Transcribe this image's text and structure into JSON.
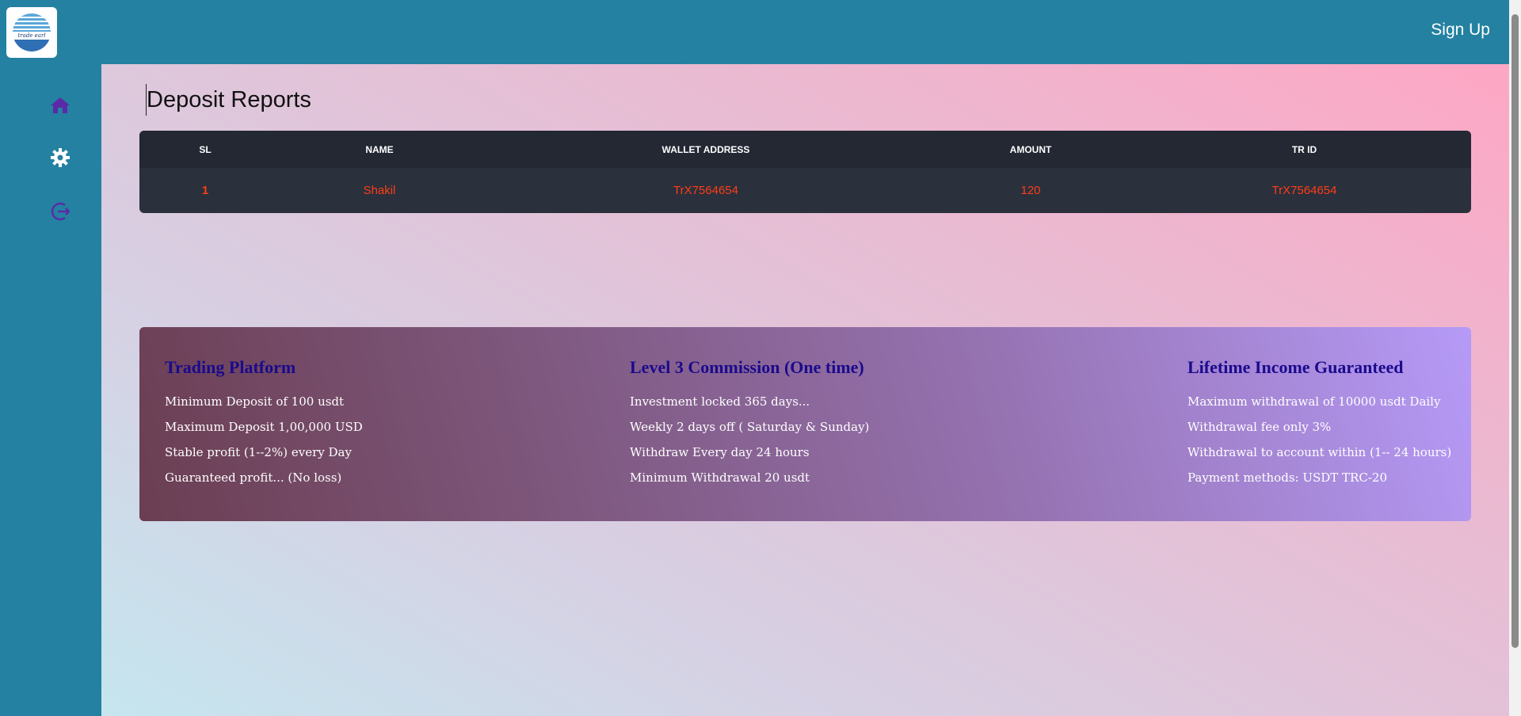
{
  "header": {
    "logo_text": "trade earl",
    "signup_label": "Sign Up"
  },
  "sidebar": {
    "items": [
      {
        "icon": "home-icon"
      },
      {
        "icon": "gear-icon"
      },
      {
        "icon": "logout-icon"
      }
    ]
  },
  "page": {
    "title": "Deposit Reports"
  },
  "table": {
    "headers": [
      "SL",
      "NAME",
      "WALLET ADDRESS",
      "AMOUNT",
      "TR ID"
    ],
    "rows": [
      [
        "1",
        "Shakil",
        "TrX7564654",
        "120",
        "TrX7564654"
      ]
    ]
  },
  "info": {
    "columns": [
      {
        "title": "Trading Platform",
        "lines": [
          "Minimum Deposit of 100 usdt",
          "Maximum Deposit 1,00,000 USD",
          "Stable profit (1--2%) every Day",
          "Guaranteed profit... (No loss)"
        ]
      },
      {
        "title": "Level 3 Commission (One time)",
        "lines": [
          "Investment locked 365 days...",
          "Weekly 2 days off ( Saturday & Sunday)",
          "Withdraw Every day 24 hours",
          "Minimum Withdrawal 20 usdt"
        ]
      },
      {
        "title": "Lifetime Income Guaranteed",
        "lines": [
          "Maximum withdrawal of 10000 usdt Daily",
          "Withdrawal fee only 3%",
          "Withdrawal to account within (1-- 24 hours)",
          "Payment methods: USDT TRC-20"
        ]
      }
    ]
  },
  "colors": {
    "brand": "#2481a1",
    "table_text": "#ff3d17",
    "info_title": "#1a0a8c",
    "icon_purple": "#5b2aa8"
  }
}
